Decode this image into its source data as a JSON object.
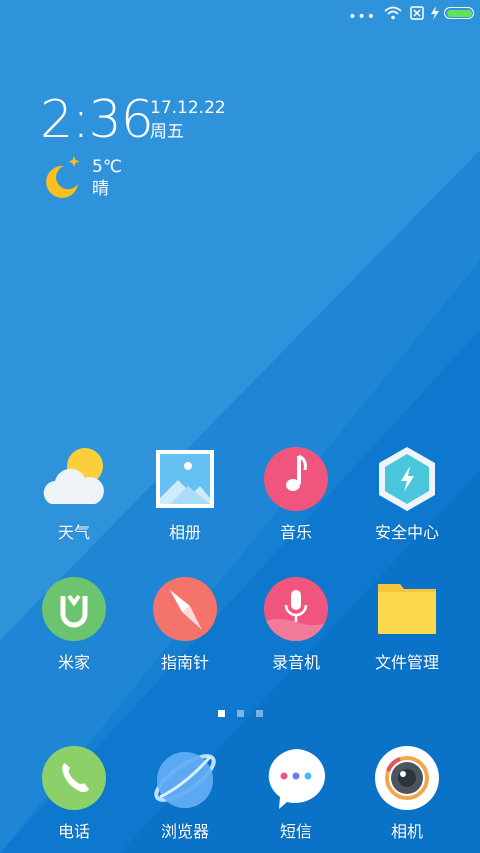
{
  "status_bar": {
    "signal_dots": "•••",
    "icons": [
      "wifi-icon",
      "sim-off-icon",
      "charging-bolt-icon",
      "battery-icon"
    ],
    "battery_level": 1.0,
    "battery_color": "#5fe35a"
  },
  "clock": {
    "time": "2:36",
    "date": "17.12.22",
    "weekday": "周五"
  },
  "weather": {
    "temperature": "5℃",
    "condition": "晴",
    "icon": "moon-icon"
  },
  "apps": [
    {
      "id": "weather",
      "label": "天气",
      "icon": "weather-app-icon"
    },
    {
      "id": "gallery",
      "label": "相册",
      "icon": "gallery-icon"
    },
    {
      "id": "music",
      "label": "音乐",
      "icon": "music-icon"
    },
    {
      "id": "security",
      "label": "安全中心",
      "icon": "security-icon"
    },
    {
      "id": "mijia",
      "label": "米家",
      "icon": "mijia-icon"
    },
    {
      "id": "compass",
      "label": "指南针",
      "icon": "compass-icon"
    },
    {
      "id": "recorder",
      "label": "录音机",
      "icon": "recorder-icon"
    },
    {
      "id": "files",
      "label": "文件管理",
      "icon": "folder-icon"
    }
  ],
  "pager": {
    "pages": 3,
    "current": 1
  },
  "dock": [
    {
      "id": "phone",
      "label": "电话",
      "icon": "phone-icon"
    },
    {
      "id": "browser",
      "label": "浏览器",
      "icon": "browser-icon"
    },
    {
      "id": "messages",
      "label": "短信",
      "icon": "messages-icon"
    },
    {
      "id": "camera",
      "label": "相机",
      "icon": "camera-icon"
    }
  ],
  "colors": {
    "wallpaper_light": "#3a9be0",
    "wallpaper_dark": "#0b77cf",
    "music": "#f0557e",
    "compass": "#f4736b",
    "mijia": "#6cc56e",
    "phone": "#8cd06a"
  }
}
